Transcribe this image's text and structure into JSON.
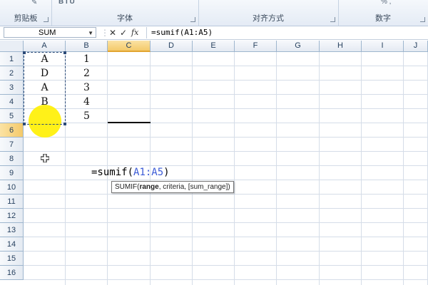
{
  "ribbon": {
    "groups": [
      {
        "title": "剪贴板"
      },
      {
        "title": "字体"
      },
      {
        "title": "对齐方式"
      },
      {
        "title": "数字"
      }
    ],
    "top_text": {
      "font_group": "B I U",
      "number_group": "% ,"
    }
  },
  "formula_bar": {
    "name_box": "SUM",
    "cancel_symbol": "✕",
    "enter_symbol": "✓",
    "fx_label": "fx",
    "formula": "=sumif(A1:A5)"
  },
  "columns": [
    "A",
    "B",
    "C",
    "D",
    "E",
    "F",
    "G",
    "H",
    "I",
    "J"
  ],
  "selected_column": "C",
  "rows": [
    "1",
    "2",
    "3",
    "4",
    "5",
    "6",
    "7",
    "8",
    "9",
    "10",
    "11",
    "12",
    "13",
    "14",
    "15",
    "16"
  ],
  "selected_row": "6",
  "cells": {
    "A1": "A",
    "A2": "D",
    "A3": "A",
    "A4": "B",
    "B1": "1",
    "B2": "2",
    "B3": "3",
    "B4": "4",
    "B5": "5"
  },
  "edit_cell": {
    "prefix": "=sumif(",
    "ref": "A1:A5",
    "suffix": ")"
  },
  "tooltip": {
    "func": "SUMIF(",
    "arg1": "range",
    "rest": ", criteria, [sum_range])"
  },
  "colors": {
    "selection_header": "#f4c96a",
    "reference_blue": "#3b5bd6",
    "marquee": "#2b4a78",
    "highlight": "#fff000"
  }
}
